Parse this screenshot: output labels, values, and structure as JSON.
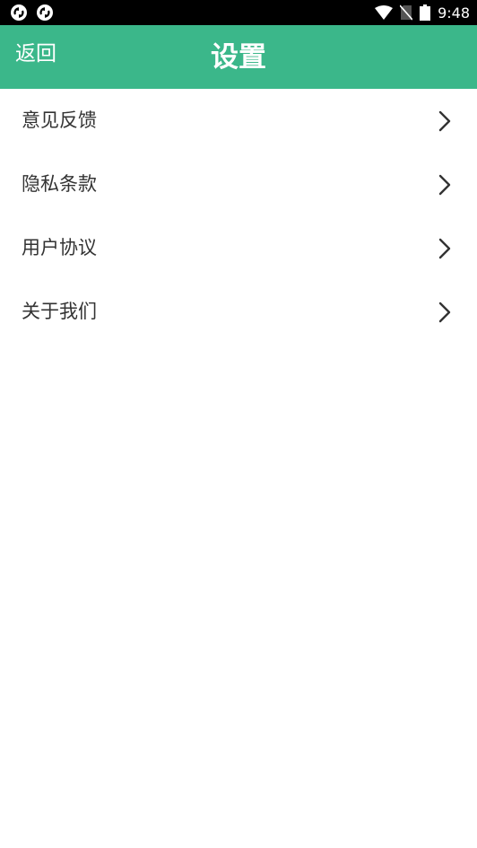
{
  "status_bar": {
    "time": "9:48",
    "left_icons": [
      "sync-app-icon",
      "sync-app-icon"
    ],
    "right_icons": [
      "wifi-icon",
      "no-sim-icon",
      "battery-icon"
    ]
  },
  "header": {
    "back_label": "返回",
    "title": "设置",
    "background_color": "#3bb78a"
  },
  "menu": {
    "items": [
      {
        "label": "意见反馈",
        "icon": "chevron-right-icon"
      },
      {
        "label": "隐私条款",
        "icon": "chevron-right-icon"
      },
      {
        "label": "用户协议",
        "icon": "chevron-right-icon"
      },
      {
        "label": "关于我们",
        "icon": "chevron-right-icon"
      }
    ]
  }
}
